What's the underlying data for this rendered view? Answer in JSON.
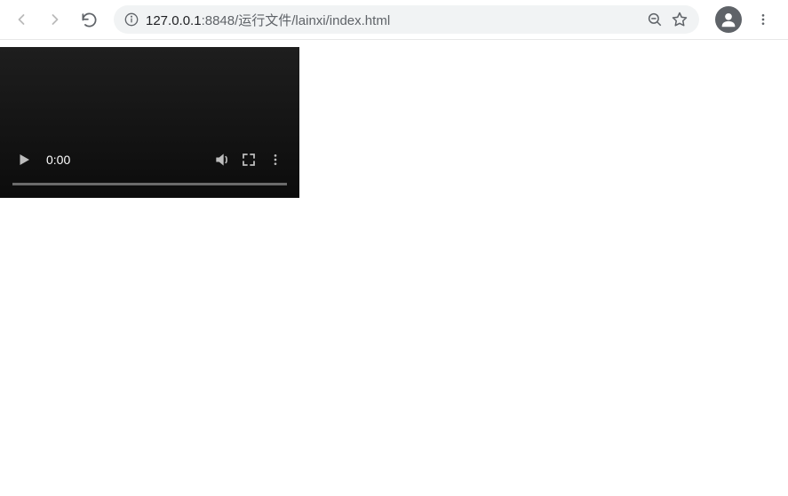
{
  "toolbar": {
    "url_host": "127.0.0.1",
    "url_rest": ":8848/运行文件/lainxi/index.html"
  },
  "video": {
    "time": "0:00"
  }
}
